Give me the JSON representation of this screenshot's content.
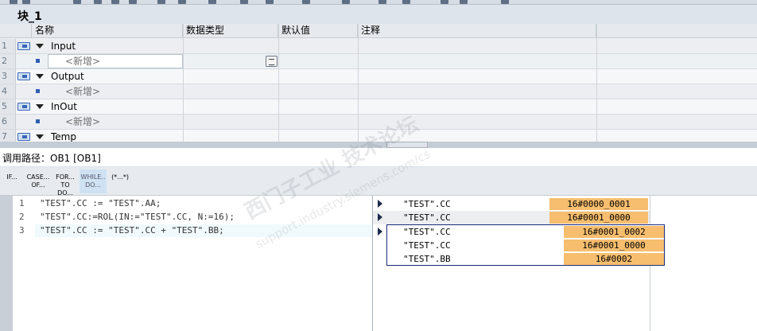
{
  "block": {
    "title": "块_1"
  },
  "interface": {
    "columns": [
      "名称",
      "数据类型",
      "默认值",
      "注释"
    ],
    "rows": [
      {
        "num": "1",
        "type": "section",
        "name": "Input"
      },
      {
        "num": "2",
        "type": "new",
        "name": "<新增>"
      },
      {
        "num": "3",
        "type": "section",
        "name": "Output"
      },
      {
        "num": "4",
        "type": "new",
        "name": "<新增>"
      },
      {
        "num": "5",
        "type": "section",
        "name": "InOut"
      },
      {
        "num": "6",
        "type": "new",
        "name": "<新增>"
      },
      {
        "num": "7",
        "type": "section",
        "name": "Temp"
      }
    ]
  },
  "callpath": {
    "text": "调用路径：OB1 [OB1]"
  },
  "instructions": [
    {
      "label": "IF...",
      "active": false
    },
    {
      "label": "CASE...\nOF...",
      "active": false
    },
    {
      "label": "FOR...\nTO DO...",
      "active": false
    },
    {
      "label": "WHILE..\nDO...",
      "active": true
    },
    {
      "label": "(*...*)",
      "active": false
    }
  ],
  "code": {
    "lines": [
      {
        "num": "1",
        "text": "\"TEST\".CC := \"TEST\".AA;"
      },
      {
        "num": "2",
        "text": "\"TEST\".CC:=ROL(IN:=\"TEST\".CC, N:=16);"
      },
      {
        "num": "3",
        "text": "\"TEST\".CC := \"TEST\".CC + \"TEST\".BB;"
      }
    ]
  },
  "monitor": {
    "rows": [
      {
        "name": "\"TEST\".CC",
        "value": "16#0000_0001"
      },
      {
        "name": "\"TEST\".CC",
        "value": "16#0001_0000"
      },
      {
        "name": "\"TEST\".CC",
        "value": "16#0001_0002"
      },
      {
        "name": "\"TEST\".CC",
        "value": "16#0001_0000"
      },
      {
        "name": "\"TEST\".BB",
        "value": "16#0002"
      }
    ]
  },
  "watermark": {
    "line1": "西门子工业 技术论坛",
    "line2": "support.industry.siemens.com/cs"
  },
  "colors": {
    "value_bg": "#f6be6e",
    "section_icon": "#3a66b4"
  }
}
